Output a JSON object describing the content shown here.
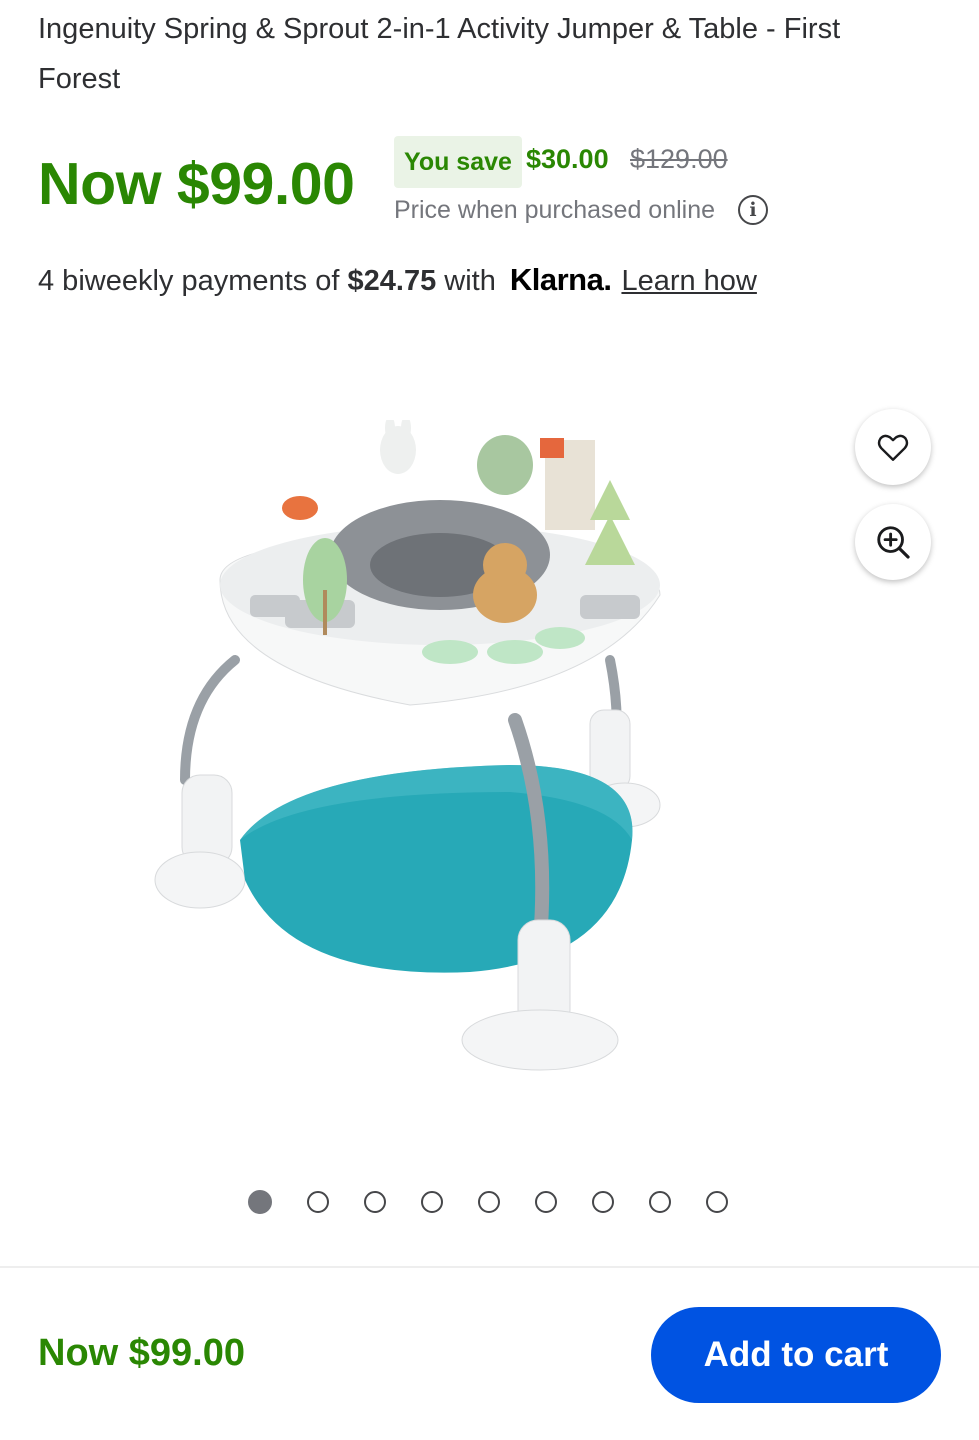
{
  "product": {
    "title": "Ingenuity Spring & Sprout 2-in-1 Activity Jumper & Table - First Forest",
    "now_price": "Now $99.00",
    "you_save_label": "You save",
    "save_amount": "$30.00",
    "was_price": "$129.00",
    "price_note": "Price when purchased online"
  },
  "klarna": {
    "prefix": "4 biweekly payments of",
    "amount": "$24.75",
    "with": "with",
    "brand": "Klarna.",
    "learn_how": "Learn how"
  },
  "gallery": {
    "image_count": 9,
    "active_index": 0,
    "favorite_icon": "heart-icon",
    "zoom_icon": "zoom-in-icon"
  },
  "footer": {
    "price": "Now $99.00",
    "add_to_cart": "Add to cart"
  },
  "colors": {
    "price_green": "#2a8703",
    "button_blue": "#0053e2",
    "save_badge_bg": "#eaf3e6"
  }
}
